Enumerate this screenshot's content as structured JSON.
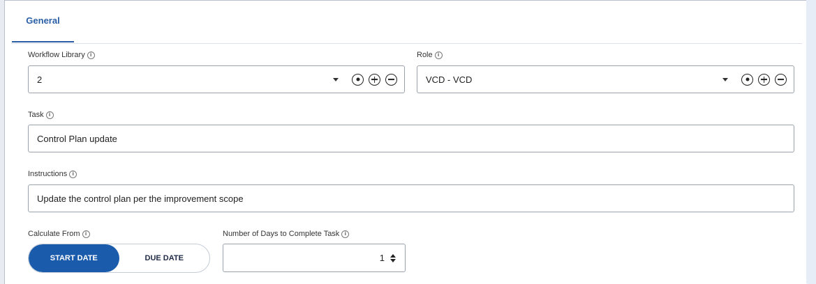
{
  "tabs": [
    {
      "label": "General",
      "active": true
    }
  ],
  "fields": {
    "workflow_library": {
      "label": "Workflow Library",
      "value": "2"
    },
    "role": {
      "label": "Role",
      "value": "VCD - VCD"
    },
    "task": {
      "label": "Task",
      "value": "Control Plan update"
    },
    "instructions": {
      "label": "Instructions",
      "value": "Update the control plan per the improvement scope"
    },
    "calculate_from": {
      "label": "Calculate From",
      "options": [
        "START DATE",
        "DUE DATE"
      ],
      "selected": "START DATE"
    },
    "days_to_complete": {
      "label": "Number of Days to Complete Task",
      "value": "1"
    }
  },
  "icons": {
    "info": "info-circle-icon",
    "select": "target-circle-icon",
    "add": "plus-circle-icon",
    "remove": "minus-circle-icon",
    "dropdown": "caret-down-icon"
  },
  "colors": {
    "accent": "#1b5bab",
    "tab_text": "#2a5fa6"
  }
}
